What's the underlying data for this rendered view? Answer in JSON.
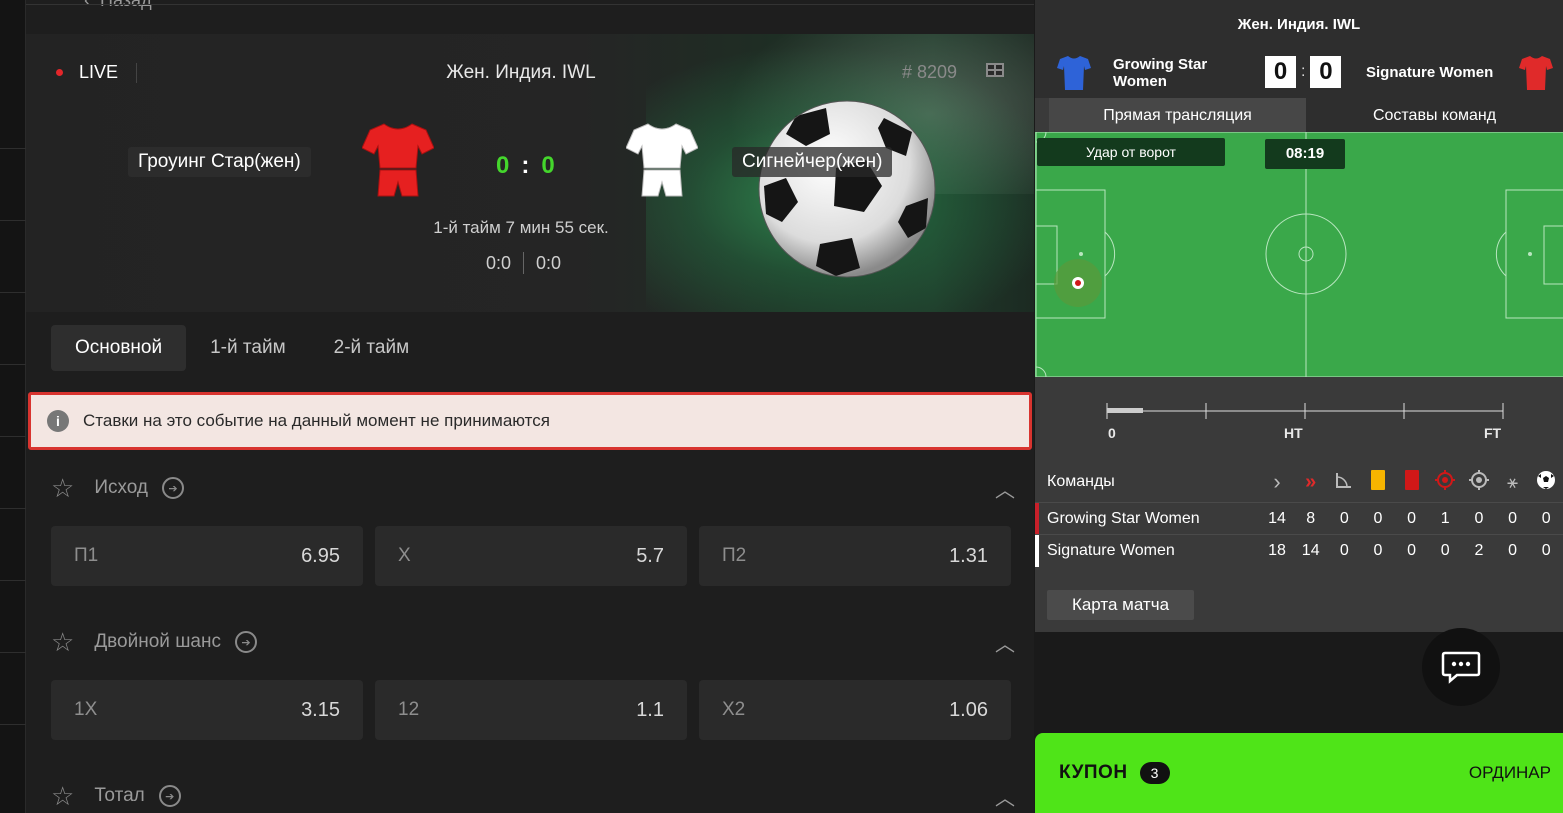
{
  "nav": {
    "back_label": "Назад"
  },
  "event": {
    "live_label": "LIVE",
    "league": "Жен. Индия. IWL",
    "event_no": "# 8209",
    "home": "Гроуинг Стар(жен)",
    "away": "Сигнейчер(жен)",
    "score_home": "0",
    "score_away": "0",
    "score_sep": ":",
    "period_time": "1-й тайм 7 мин 55 сек.",
    "half1": "0:0",
    "half2": "0:0"
  },
  "tabs": [
    "Основной",
    "1-й тайм",
    "2-й тайм"
  ],
  "notice": "Ставки на это событие на данный момент не принимаются",
  "markets": [
    {
      "title": "Исход",
      "odds": [
        {
          "label": "П1",
          "value": "6.95"
        },
        {
          "label": "X",
          "value": "5.7"
        },
        {
          "label": "П2",
          "value": "1.31"
        }
      ]
    },
    {
      "title": "Двойной шанс",
      "odds": [
        {
          "label": "1X",
          "value": "3.15"
        },
        {
          "label": "12",
          "value": "1.1"
        },
        {
          "label": "X2",
          "value": "1.06"
        }
      ]
    },
    {
      "title": "Тотал",
      "odds": []
    }
  ],
  "widget": {
    "title": "Жен. Индия. IWL",
    "home": "Growing Star Women",
    "away": "Signature Women",
    "score_home": "0",
    "score_away": "0",
    "score_sep": ":",
    "tab_live": "Прямая трансляция",
    "tab_lineups": "Составы команд",
    "pitch_event": "Удар от ворот",
    "pitch_clock": "08:19",
    "timeline_labels": [
      "0",
      "HT",
      "FT"
    ],
    "timeline_progress": 0.09,
    "stats_header": "Команды",
    "stats_rows": [
      {
        "team": "Growing Star Women",
        "values": [
          "14",
          "8",
          "0",
          "0",
          "0",
          "1",
          "0",
          "0",
          "0"
        ],
        "color": "#c8202a"
      },
      {
        "team": "Signature Women",
        "values": [
          "18",
          "14",
          "0",
          "0",
          "0",
          "0",
          "2",
          "0",
          "0"
        ],
        "color": "#ffffff"
      }
    ],
    "match_map_label": "Карта матча"
  },
  "coupon": {
    "label": "КУПОН",
    "count": "3",
    "mode": "ОРДИНАР"
  },
  "colors": {
    "accent_green": "#44d62c",
    "coupon_green": "#4fe418",
    "home_shirt": "#e62020",
    "away_shirt": "#ffffff",
    "notice_border": "#d8342f"
  }
}
